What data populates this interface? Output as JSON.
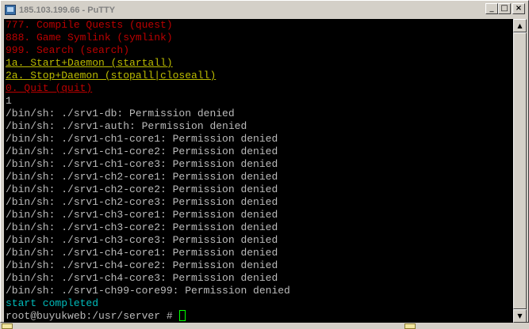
{
  "window": {
    "title": "185.103.199.66 - PuTTY",
    "buttons": {
      "minimize": "_",
      "maximize": "□",
      "close": "×"
    }
  },
  "terminal": {
    "menu": [
      {
        "text": "777. Compile Quests (quest)",
        "style": "red"
      },
      {
        "text": "888. Game Symlink (symlink)",
        "style": "red"
      },
      {
        "text": "999. Search (search)",
        "style": "red"
      },
      {
        "text": "1a. Start+Daemon (startall)",
        "style": "yellow-ul"
      },
      {
        "text": "2a. Stop+Daemon (stopall|closeall)",
        "style": "yellow-ul"
      },
      {
        "text": "0. Quit (quit)",
        "style": "red-ul"
      }
    ],
    "input_echo": "1",
    "output": [
      "/bin/sh: ./srv1-db: Permission denied",
      "/bin/sh: ./srv1-auth: Permission denied",
      "/bin/sh: ./srv1-ch1-core1: Permission denied",
      "/bin/sh: ./srv1-ch1-core2: Permission denied",
      "/bin/sh: ./srv1-ch1-core3: Permission denied",
      "/bin/sh: ./srv1-ch2-core1: Permission denied",
      "/bin/sh: ./srv1-ch2-core2: Permission denied",
      "/bin/sh: ./srv1-ch2-core3: Permission denied",
      "/bin/sh: ./srv1-ch3-core1: Permission denied",
      "/bin/sh: ./srv1-ch3-core2: Permission denied",
      "/bin/sh: ./srv1-ch3-core3: Permission denied",
      "/bin/sh: ./srv1-ch4-core1: Permission denied",
      "/bin/sh: ./srv1-ch4-core2: Permission denied",
      "/bin/sh: ./srv1-ch4-core3: Permission denied",
      "/bin/sh: ./srv1-ch99-core99: Permission denied"
    ],
    "status": "start completed",
    "prompt": "root@buyukweb:/usr/server # "
  },
  "scrollbar": {
    "up": "▲",
    "down": "▼"
  },
  "colors": {
    "red": "#bb0000",
    "yellow": "#bbbb00",
    "cyan": "#00bbbb",
    "default": "#bbbbbb",
    "cursor": "#00ff00",
    "background": "#000000"
  }
}
